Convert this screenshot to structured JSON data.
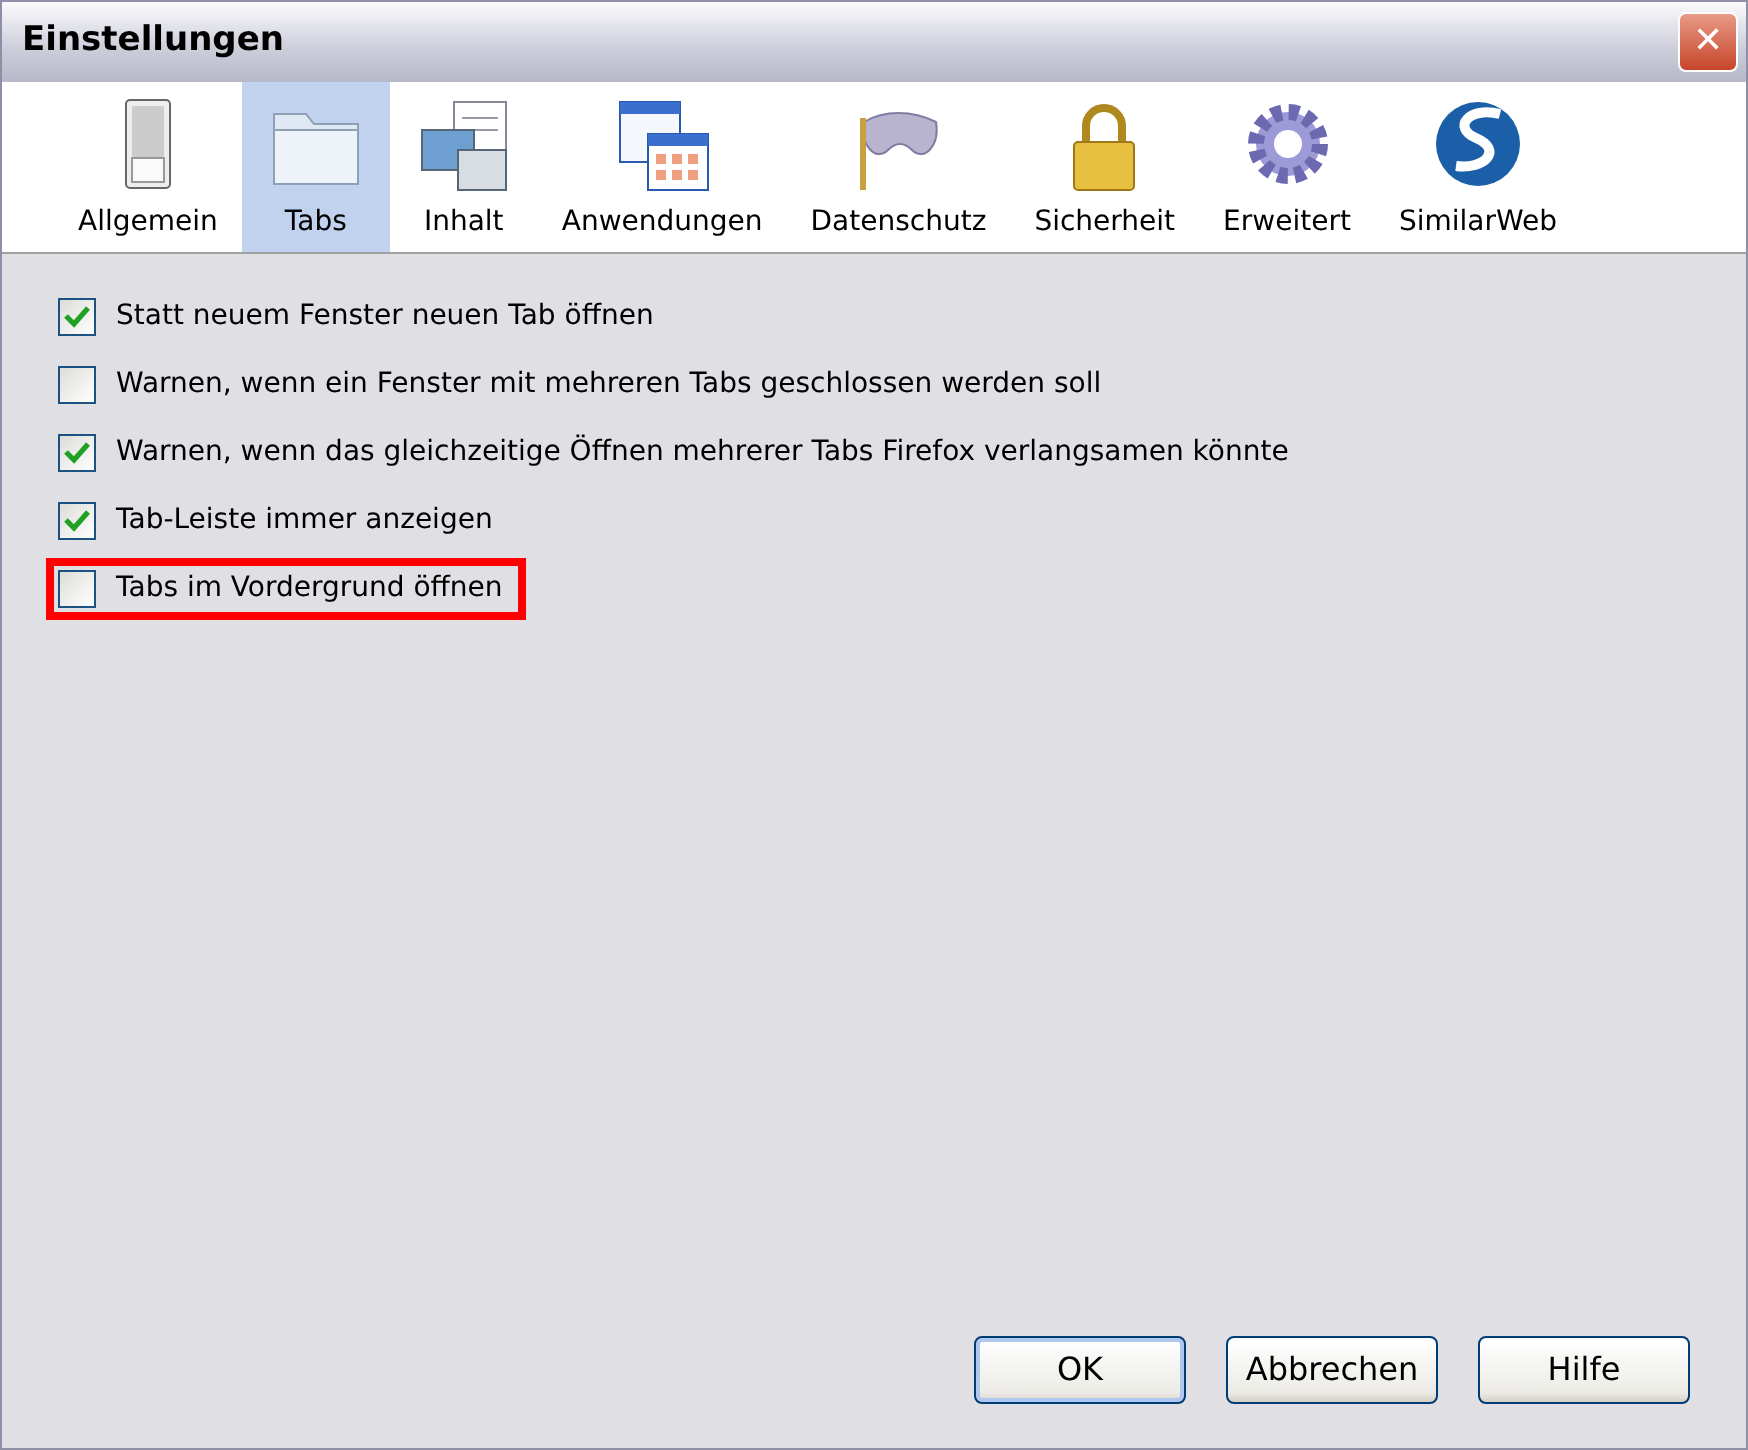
{
  "window": {
    "title": "Einstellungen",
    "close_label": "✕"
  },
  "panes": [
    {
      "label": "Allgemein",
      "selected": false
    },
    {
      "label": "Tabs",
      "selected": true
    },
    {
      "label": "Inhalt",
      "selected": false
    },
    {
      "label": "Anwendungen",
      "selected": false
    },
    {
      "label": "Datenschutz",
      "selected": false
    },
    {
      "label": "Sicherheit",
      "selected": false
    },
    {
      "label": "Erweitert",
      "selected": false
    },
    {
      "label": "SimilarWeb",
      "selected": false
    }
  ],
  "options": [
    {
      "label": "Statt neuem Fenster neuen Tab öffnen",
      "checked": true,
      "highlighted": false
    },
    {
      "label": "Warnen, wenn ein Fenster mit mehreren Tabs geschlossen werden soll",
      "checked": false,
      "highlighted": false
    },
    {
      "label": "Warnen, wenn das gleichzeitige Öffnen mehrerer Tabs Firefox verlangsamen könnte",
      "checked": true,
      "highlighted": false
    },
    {
      "label": "Tab-Leiste immer anzeigen",
      "checked": true,
      "highlighted": false
    },
    {
      "label": "Tabs im Vordergrund öffnen",
      "checked": false,
      "highlighted": true
    }
  ],
  "buttons": [
    "OK",
    "Abbrechen",
    "Hilfe"
  ]
}
